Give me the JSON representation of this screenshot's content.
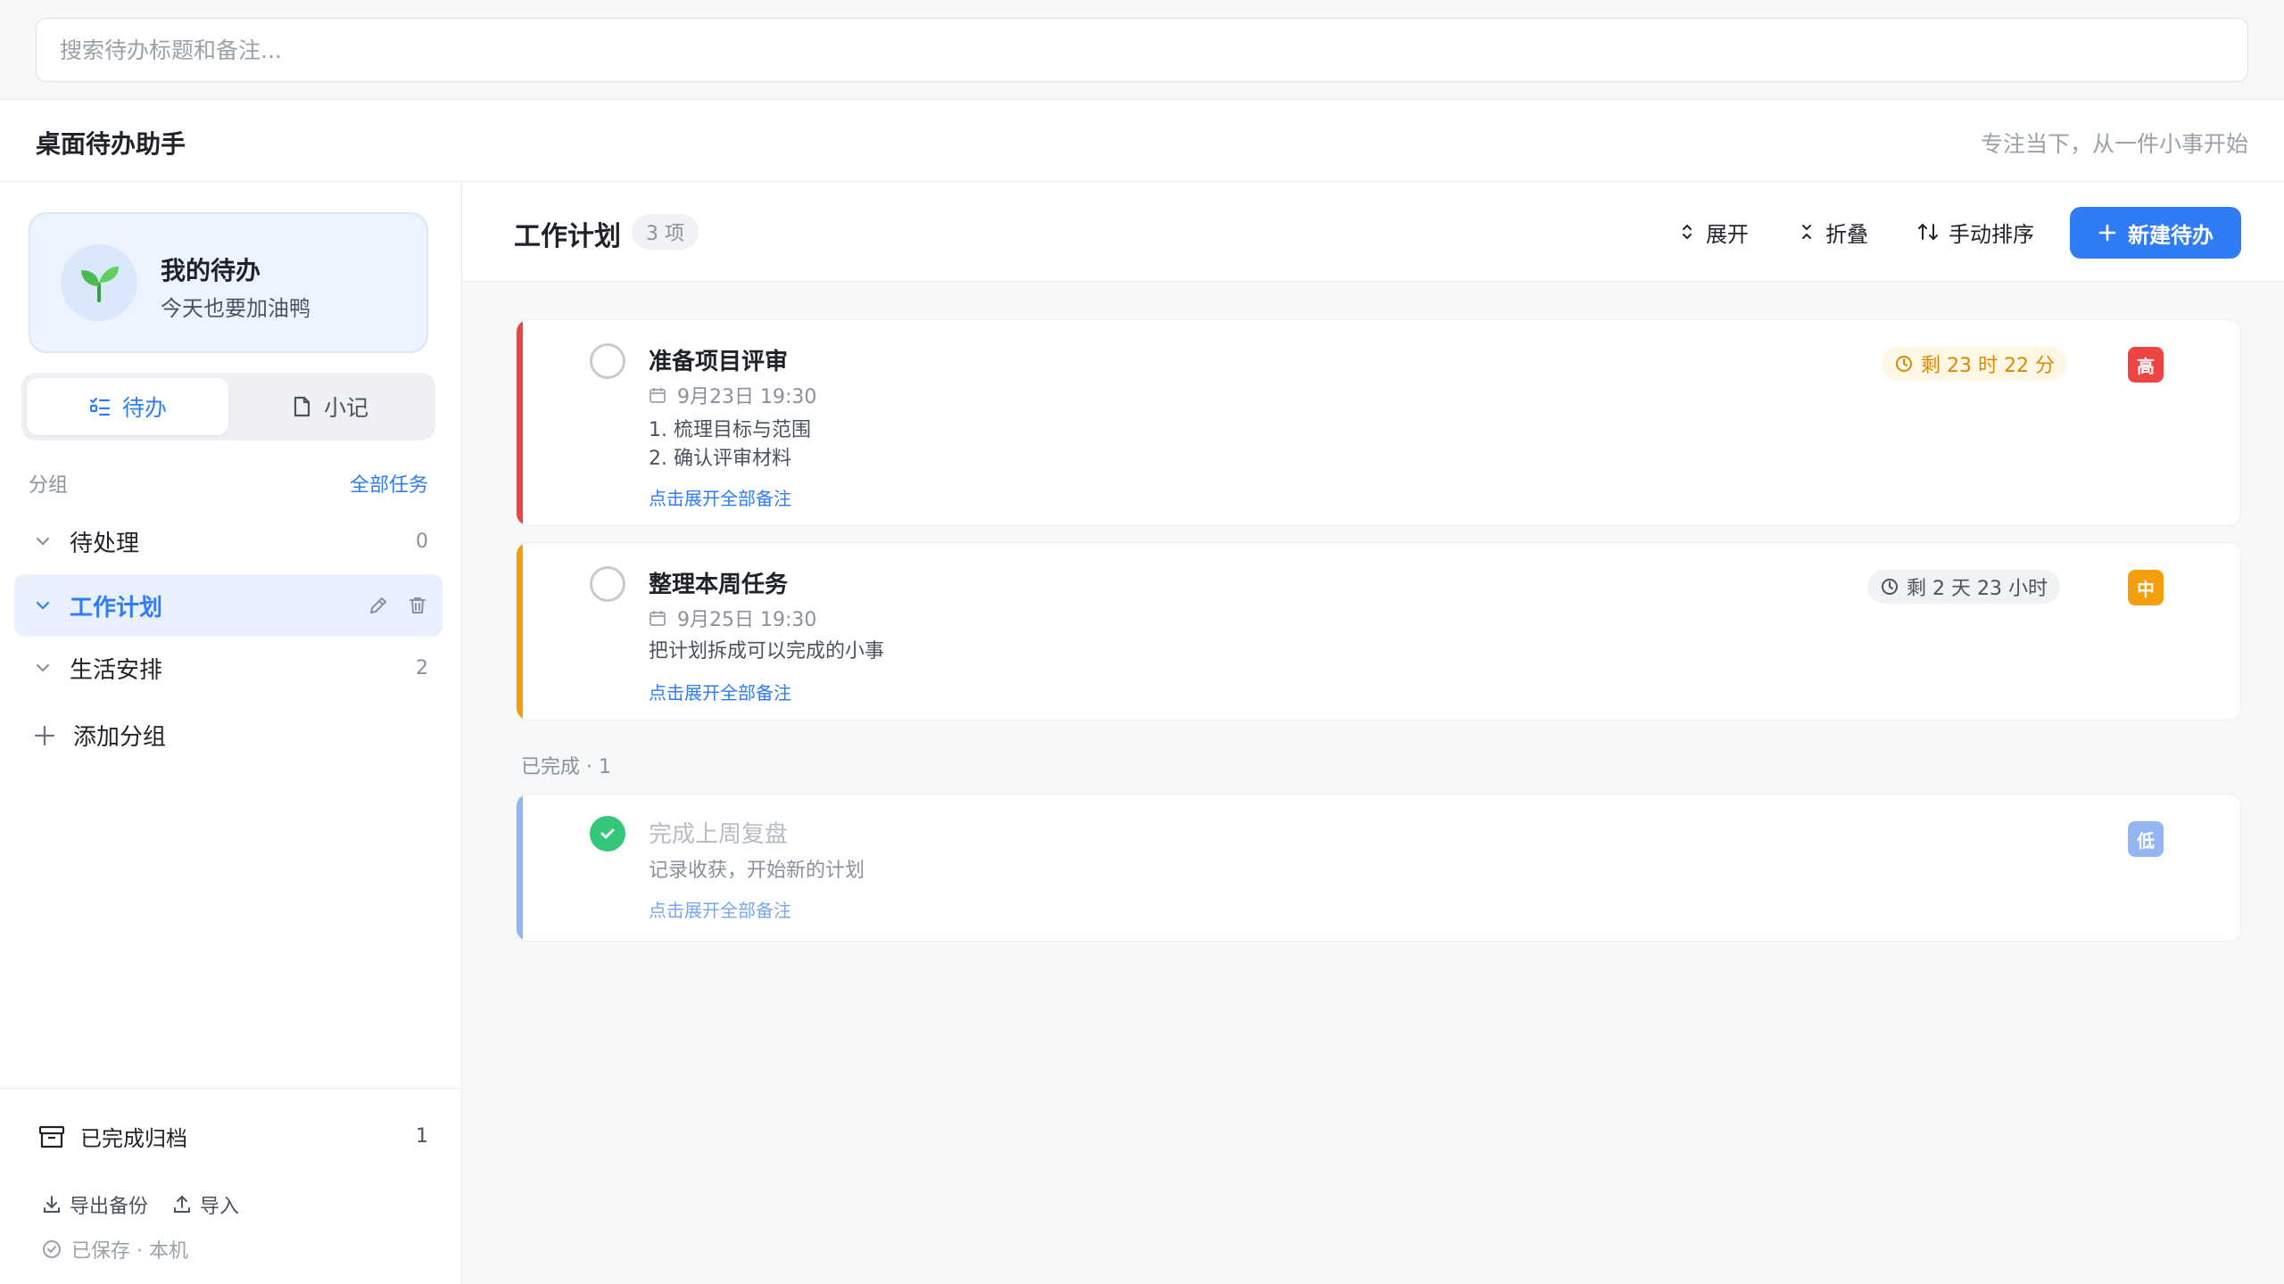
{
  "search": {
    "placeholder": "搜索待办标题和备注..."
  },
  "app": {
    "title": "桌面待办助手",
    "slogan": "专注当下，从一件小事开始"
  },
  "profile": {
    "name": "我的待办",
    "subtitle": "今天也要加油鸭",
    "avatar_icon": "sprout-icon"
  },
  "view_tabs": [
    {
      "label": "待办",
      "active": true,
      "icon": "checklist-icon"
    },
    {
      "label": "小记",
      "active": false,
      "icon": "note-icon"
    }
  ],
  "groups_header": {
    "label": "分组",
    "all_tasks": "全部任务"
  },
  "groups": [
    {
      "name": "待处理",
      "count": "0",
      "active": false
    },
    {
      "name": "工作计划",
      "count": "",
      "active": true
    },
    {
      "name": "生活安排",
      "count": "2",
      "active": false
    }
  ],
  "add_group": "添加分组",
  "footer": {
    "archive_label": "已完成归档",
    "archive_count": "1",
    "export": "导出备份",
    "import": "导入",
    "saved": "已保存 · 本机"
  },
  "main": {
    "title": "工作计划",
    "count": "3 项",
    "expand": "展开",
    "collapse": "折叠",
    "sort": "手动排序",
    "new": "新建待办",
    "completed_label": "已完成 · 1"
  },
  "tasks": [
    {
      "title": "准备项目评审",
      "date": "9月23日 19:30",
      "notes": [
        "1. 梳理目标与范围",
        "2. 确认评审材料"
      ],
      "expand": "点击展开全部备注",
      "remaining": "剩 23 时 22 分",
      "priority": "高",
      "color": "#ef4444",
      "done": false
    },
    {
      "title": "整理本周任务",
      "date": "9月25日 19:30",
      "notes": [
        "把计划拆成可以完成的小事"
      ],
      "expand": "点击展开全部备注",
      "remaining": "剩 2 天 23 小时",
      "priority": "中",
      "color": "#f59e0b",
      "done": false
    },
    {
      "title": "完成上周复盘",
      "notes": [
        "记录收获，开始新的计划"
      ],
      "expand": "点击展开全部备注",
      "priority": "低",
      "color": "#93b6f3",
      "done": true
    }
  ],
  "colors": {
    "accent": "#2f7cf6",
    "high": "#ef4444",
    "medium": "#f59e0b",
    "low": "#93b6f3",
    "done": "#34c77b"
  }
}
